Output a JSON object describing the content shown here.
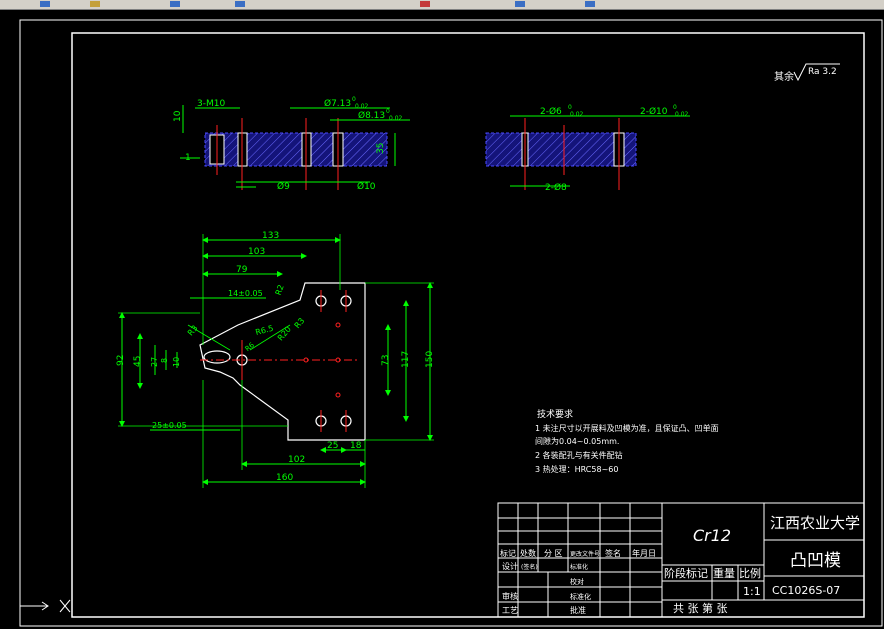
{
  "drawing": {
    "roughness_label": "其余",
    "roughness_value": "Ra 3.2",
    "top_view": {
      "thread": "3-M10",
      "dim_7_13": "Ø7.13",
      "tol_7_13": "0",
      "tol_7_13_low": "0.02",
      "dim_8_13": "Ø8.13",
      "tol_8_13": "0",
      "tol_8_13_low": "0.02",
      "dim_10_left": "10",
      "dim_1": "1",
      "dim_35": "35",
      "dim_d9": "Ø9",
      "dim_d10": "Ø10"
    },
    "right_view": {
      "dim_2d6": "2-Ø6",
      "tol_2d6": "0",
      "tol_2d6_low": "0.02",
      "dim_2d10": "2-Ø10",
      "tol_2d10": "0",
      "tol_2d10_low": "0.02",
      "dim_2d8": "2-Ø8"
    },
    "plan_view": {
      "d133": "133",
      "d103": "103",
      "d79": "79",
      "d14": "14±0.05",
      "d45": "45",
      "d92": "92",
      "d27": "27",
      "d8": "8",
      "d10": "10",
      "r2": "R2",
      "r3": "R3",
      "r65": "R6.5",
      "r20": "R20",
      "r3b": "R3",
      "r6": "R6",
      "d25": "25±0.05",
      "d73": "73",
      "d117": "117",
      "d150": "150",
      "d102": "102",
      "d160": "160",
      "d25b": "25",
      "d18": "18"
    },
    "tech_req": {
      "title": "技术要求",
      "line1": "1  未注尺寸以开展料及凹模为准，且保证凸、凹单面",
      "line2": "间隙为0.04~0.05mm.",
      "line3": "2  各装配孔与有关件配钻",
      "line4": "3  热处理：HRC58~60"
    }
  },
  "title_block": {
    "material": "Cr12",
    "school": "江西农业大学",
    "part_name": "凸凹模",
    "drawing_no": "CC1026S-07",
    "scale": "1:1",
    "stage_mark": "阶段标记",
    "weight": "重量",
    "ratio": "比例",
    "sheets": "共  张  第  张",
    "rev_labels": [
      "标记",
      "处数",
      "分 区",
      "更改文件号",
      "签名",
      "年月日"
    ],
    "design": "设计",
    "standard_sig": "(签名)",
    "standardize": "标准化",
    "approve_audit": "审核",
    "process": "工艺",
    "approve": "批准",
    "check": "校对",
    "rate": "标准化"
  },
  "colors": {
    "outline": "#ffffff",
    "dimension": "#00ff00",
    "part": "#4a4aff",
    "center": "#ff2020",
    "text": "#ffffff",
    "toolbar": "#d4d0c8"
  }
}
